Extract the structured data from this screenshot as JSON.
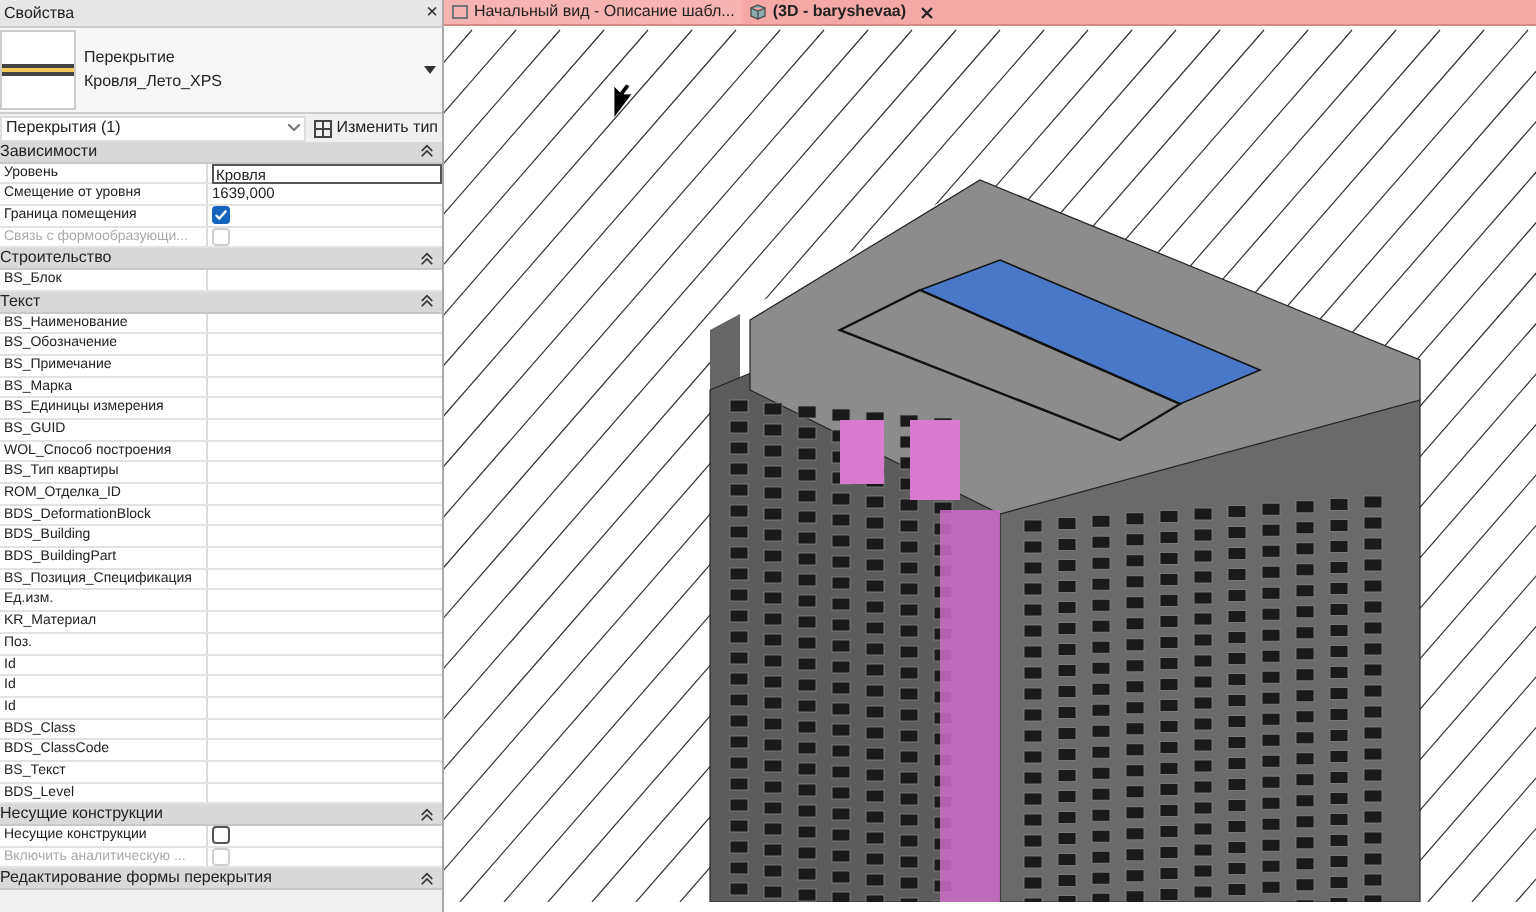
{
  "properties": {
    "title": "Свойства",
    "close": "×",
    "type_family": "Перекрытие",
    "type_name": "Кровля_Лето_XPS",
    "selector": "Перекрытия (1)",
    "edit_type": "Изменить тип",
    "groups": [
      {
        "name": "Зависимости",
        "rows": [
          {
            "kind": "text",
            "label": "Уровень",
            "value": "Кровля",
            "disabled": false,
            "editing": true
          },
          {
            "kind": "text",
            "label": "Смещение от уровня",
            "value": "1639,000",
            "disabled": false,
            "editing": false
          },
          {
            "kind": "checkbox",
            "label": "Граница помещения",
            "checked": true,
            "disabled": false
          },
          {
            "kind": "checkbox",
            "label": "Связь с формообразующи...",
            "checked": false,
            "disabled": true
          }
        ]
      },
      {
        "name": "Строительство",
        "rows": [
          {
            "kind": "text",
            "label": "BS_Блок",
            "disabled": false,
            "editing": false
          }
        ]
      },
      {
        "name": "Текст",
        "rows": [
          {
            "kind": "text",
            "label": "BS_Наименование",
            "disabled": false,
            "editing": false
          },
          {
            "kind": "text",
            "label": "BS_Обозначение",
            "disabled": false,
            "editing": false
          },
          {
            "kind": "text",
            "label": "BS_Примечание",
            "disabled": false,
            "editing": false
          },
          {
            "kind": "text",
            "label": "BS_Марка",
            "disabled": false,
            "editing": false
          },
          {
            "kind": "text",
            "label": "BS_Единицы измерения",
            "disabled": false,
            "editing": false
          },
          {
            "kind": "text",
            "label": "BS_GUID",
            "disabled": false,
            "editing": false
          },
          {
            "kind": "text",
            "label": "WOL_Способ построения",
            "disabled": false,
            "editing": false
          },
          {
            "kind": "text",
            "label": "BS_Тип квартиры",
            "disabled": false,
            "editing": false
          },
          {
            "kind": "text",
            "label": "ROM_Отделка_ID",
            "disabled": false,
            "editing": false
          },
          {
            "kind": "text",
            "label": "BDS_DeformationBlock",
            "disabled": false,
            "editing": false
          },
          {
            "kind": "text",
            "label": "BDS_Building",
            "disabled": false,
            "editing": false
          },
          {
            "kind": "text",
            "label": "BDS_BuildingPart",
            "disabled": false,
            "editing": false
          },
          {
            "kind": "text",
            "label": "BS_Позиция_Спецификация",
            "disabled": false,
            "editing": false
          },
          {
            "kind": "text",
            "label": "Ед.изм.",
            "disabled": false,
            "editing": false
          },
          {
            "kind": "text",
            "label": "KR_Материал",
            "disabled": false,
            "editing": false
          },
          {
            "kind": "text",
            "label": "Поз.",
            "disabled": false,
            "editing": false
          },
          {
            "kind": "text",
            "label": "Id",
            "disabled": false,
            "editing": false
          },
          {
            "kind": "text",
            "label": "Id",
            "disabled": false,
            "editing": false
          },
          {
            "kind": "text",
            "label": "Id",
            "disabled": false,
            "editing": false
          },
          {
            "kind": "text",
            "label": "BDS_Class",
            "disabled": false,
            "editing": false
          },
          {
            "kind": "text",
            "label": "BDS_ClassCode",
            "disabled": false,
            "editing": false
          },
          {
            "kind": "text",
            "label": "BS_Текст",
            "disabled": false,
            "editing": false
          },
          {
            "kind": "text",
            "label": "BDS_Level",
            "disabled": false,
            "editing": false
          }
        ]
      },
      {
        "name": "Несущие конструкции",
        "rows": [
          {
            "kind": "checkbox",
            "label": "Несущие конструкции",
            "checked": false,
            "disabled": false
          },
          {
            "kind": "checkbox",
            "label": "Включить аналитическую ...",
            "checked": false,
            "disabled": true
          }
        ]
      },
      {
        "name": "Редактирование формы перекрытия"
      }
    ]
  },
  "tabs": [
    {
      "label": "Начальный вид - Описание шабл...",
      "selected": false,
      "closable": false
    },
    {
      "label": "(3D - baryshevaa)",
      "selected": true,
      "closable": true
    }
  ]
}
